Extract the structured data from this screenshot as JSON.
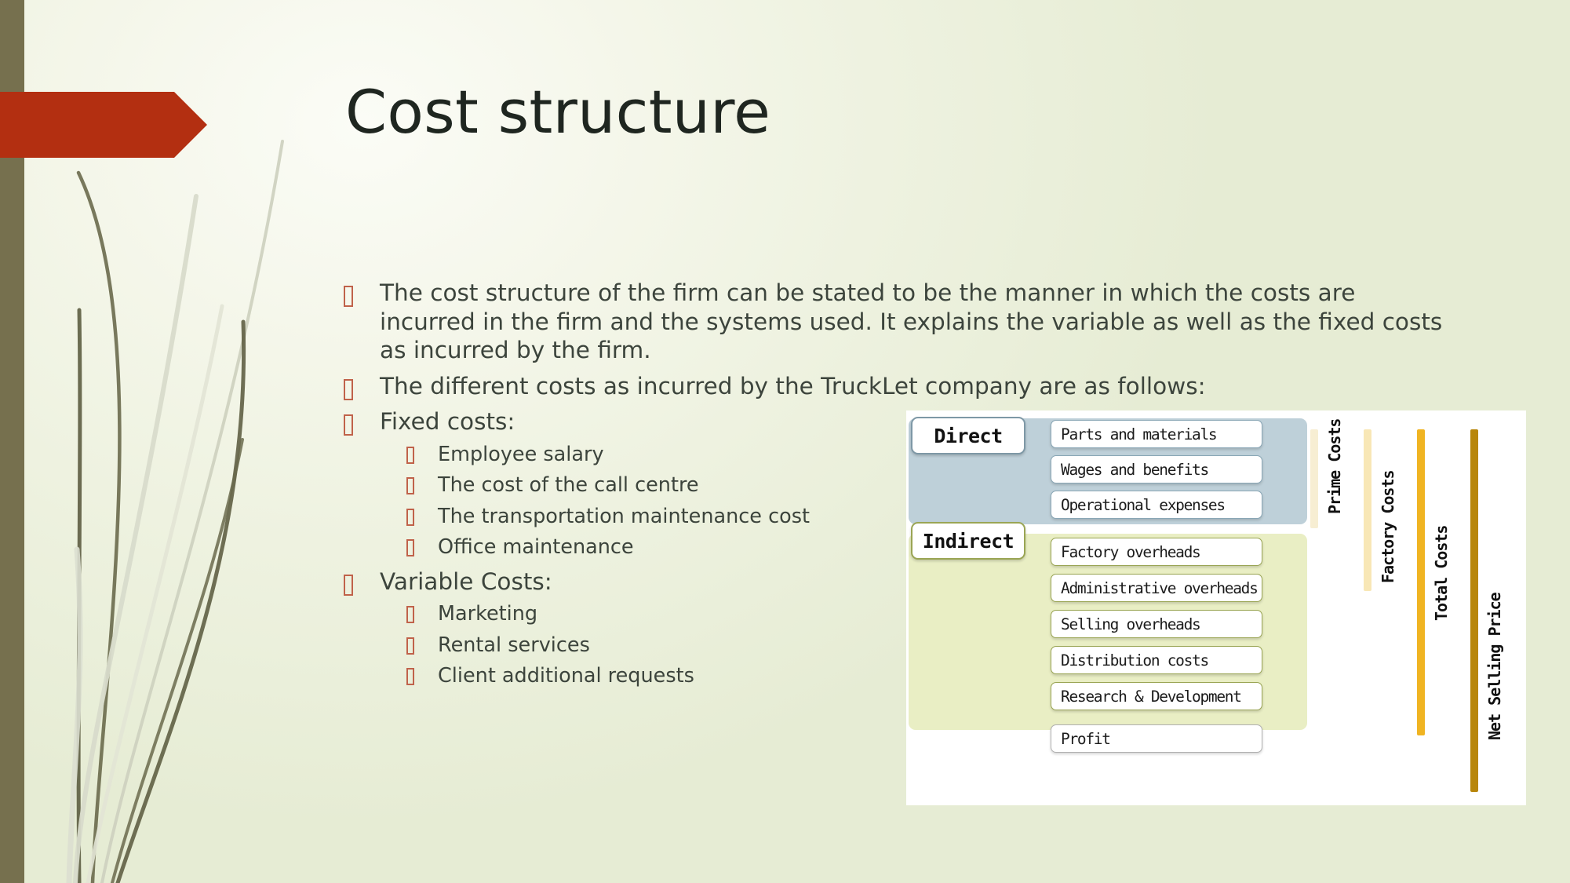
{
  "slide": {
    "title": "Cost structure",
    "theme_colors": {
      "background_light": "#f5f7ea",
      "background_dark": "#e6ecd4",
      "left_band": "#76704e",
      "accent_chevron": "#b32f11",
      "bullet_outline": "#c0624a",
      "body_text": "#3c443c",
      "title_text": "#1f2620"
    }
  },
  "content": {
    "bullets": [
      {
        "level": 1,
        "text": "The cost structure of the firm can be stated to be the manner in which the costs are incurred in the firm and the systems used. It explains the variable as well as the fixed costs as incurred by the firm."
      },
      {
        "level": 1,
        "text": "The different costs as incurred by the TruckLet company are as follows:"
      },
      {
        "level": 1,
        "text": "Fixed costs:"
      },
      {
        "level": 2,
        "text": "Employee salary"
      },
      {
        "level": 2,
        "text": "The cost of the call centre"
      },
      {
        "level": 2,
        "text": "The transportation maintenance cost"
      },
      {
        "level": 2,
        "text": "Office maintenance"
      },
      {
        "level": 1,
        "text": "Variable Costs:"
      },
      {
        "level": 2,
        "text": "Marketing"
      },
      {
        "level": 2,
        "text": "Rental services"
      },
      {
        "level": 2,
        "text": "Client additional requests"
      }
    ]
  },
  "diagram": {
    "categories": [
      {
        "name": "Direct",
        "band_color": "#bed0d9",
        "border_color": "#7e98a6"
      },
      {
        "name": "Indirect",
        "band_color": "#e9eec4",
        "border_color": "#9aa554"
      }
    ],
    "direct_items": [
      "Parts and materials",
      "Wages and benefits",
      "Operational expenses"
    ],
    "indirect_items": [
      "Factory overheads",
      "Administrative overheads",
      "Selling overheads",
      "Distribution costs",
      "Research & Development"
    ],
    "profit_item": "Profit",
    "measures": [
      {
        "label": "Prime Costs",
        "color": "#f7eed3"
      },
      {
        "label": "Factory Costs",
        "color": "#f8e7b6"
      },
      {
        "label": "Total Costs",
        "color": "#f0b422"
      },
      {
        "label": "Net Selling Price",
        "color": "#b8860b"
      }
    ]
  }
}
